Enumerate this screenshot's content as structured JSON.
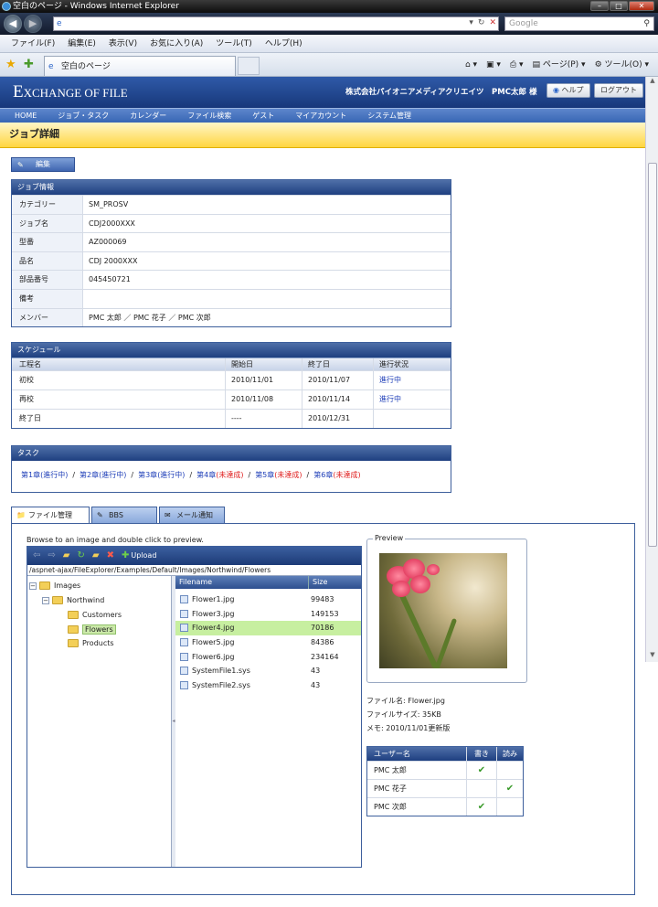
{
  "browser": {
    "title": "空白のページ - Windows Internet Explorer",
    "search_placeholder": "Google",
    "menu": [
      "ファイル(F)",
      "編集(E)",
      "表示(V)",
      "お気に入り(A)",
      "ツール(T)",
      "ヘルプ(H)"
    ],
    "tab_title": "空白のページ",
    "cmd_page": "ページ(P)",
    "cmd_tools": "ツール(O)"
  },
  "site": {
    "logo_first": "E",
    "logo_rest": "XCHANGE OF FILE",
    "company": "株式会社パイオニアメディアクリエイツ　PMC太郎 様",
    "help": "ヘルプ",
    "logout": "ログアウト",
    "nav": [
      "HOME",
      "ジョブ・タスク",
      "カレンダー",
      "ファイル検索",
      "ゲスト",
      "マイアカウント",
      "システム管理"
    ],
    "page_title": "ジョブ詳細",
    "edit": "編集"
  },
  "job": {
    "heading": "ジョブ情報",
    "rows": [
      {
        "k": "カテゴリー",
        "v": "SM_PROSV"
      },
      {
        "k": "ジョブ名",
        "v": "CDJ2000XXX"
      },
      {
        "k": "型番",
        "v": "AZ000069"
      },
      {
        "k": "品名",
        "v": "CDJ 2000XXX"
      },
      {
        "k": "部品番号",
        "v": "045450721"
      },
      {
        "k": "備考",
        "v": ""
      },
      {
        "k": "メンバー",
        "v": "PMC 太郎 ／ PMC 花子 ／ PMC 次郎"
      }
    ]
  },
  "schedule": {
    "heading": "スケジュール",
    "cols": [
      "工程名",
      "開始日",
      "終了日",
      "進行状況"
    ],
    "rows": [
      [
        "初校",
        "2010/11/01",
        "2010/11/07",
        "進行中"
      ],
      [
        "再校",
        "2010/11/08",
        "2010/11/14",
        "進行中"
      ],
      [
        "終了日",
        "----",
        "2010/12/31",
        ""
      ]
    ]
  },
  "tasks": {
    "heading": "タスク",
    "items": [
      {
        "name": "第1章",
        "status": "(進行中)"
      },
      {
        "name": "第2章",
        "status": "(進行中)"
      },
      {
        "name": "第3章",
        "status": "(進行中)"
      },
      {
        "name": "第4章",
        "status": "(未達成)"
      },
      {
        "name": "第5章",
        "status": "(未達成)"
      },
      {
        "name": "第6章",
        "status": "(未達成)"
      }
    ]
  },
  "tabs": [
    "ファイル管理",
    "BBS",
    "メール通知"
  ],
  "explorer": {
    "caption": "Browse to an image and double click to preview.",
    "upload": "Upload",
    "path": "/aspnet-ajax/FileExplorer/Examples/Default/Images/Northwind/Flowers",
    "tree": [
      "Images",
      "Northwind",
      "Customers",
      "Flowers",
      "Products"
    ],
    "col_name": "Filename",
    "col_size": "Size",
    "files": [
      {
        "name": "Flower1.jpg",
        "size": "99483"
      },
      {
        "name": "Flower3.jpg",
        "size": "149153"
      },
      {
        "name": "Flower4.jpg",
        "size": "70186"
      },
      {
        "name": "Flower5.jpg",
        "size": "84386"
      },
      {
        "name": "Flower6.jpg",
        "size": "234164"
      },
      {
        "name": "SystemFile1.sys",
        "size": "43"
      },
      {
        "name": "SystemFile2.sys",
        "size": "43"
      }
    ]
  },
  "preview": {
    "legend": "Preview",
    "filename": "ファイル名: Flower.jpg",
    "filesize": "ファイルサイズ: 35KB",
    "memo": "メモ: 2010/11/01更新版"
  },
  "users": {
    "cols": [
      "ユーザー名",
      "書き",
      "読み"
    ],
    "rows": [
      {
        "name": "PMC 太郎",
        "write": true,
        "read": false
      },
      {
        "name": "PMC 花子",
        "write": false,
        "read": true
      },
      {
        "name": "PMC 次郎",
        "write": true,
        "read": false
      }
    ]
  }
}
